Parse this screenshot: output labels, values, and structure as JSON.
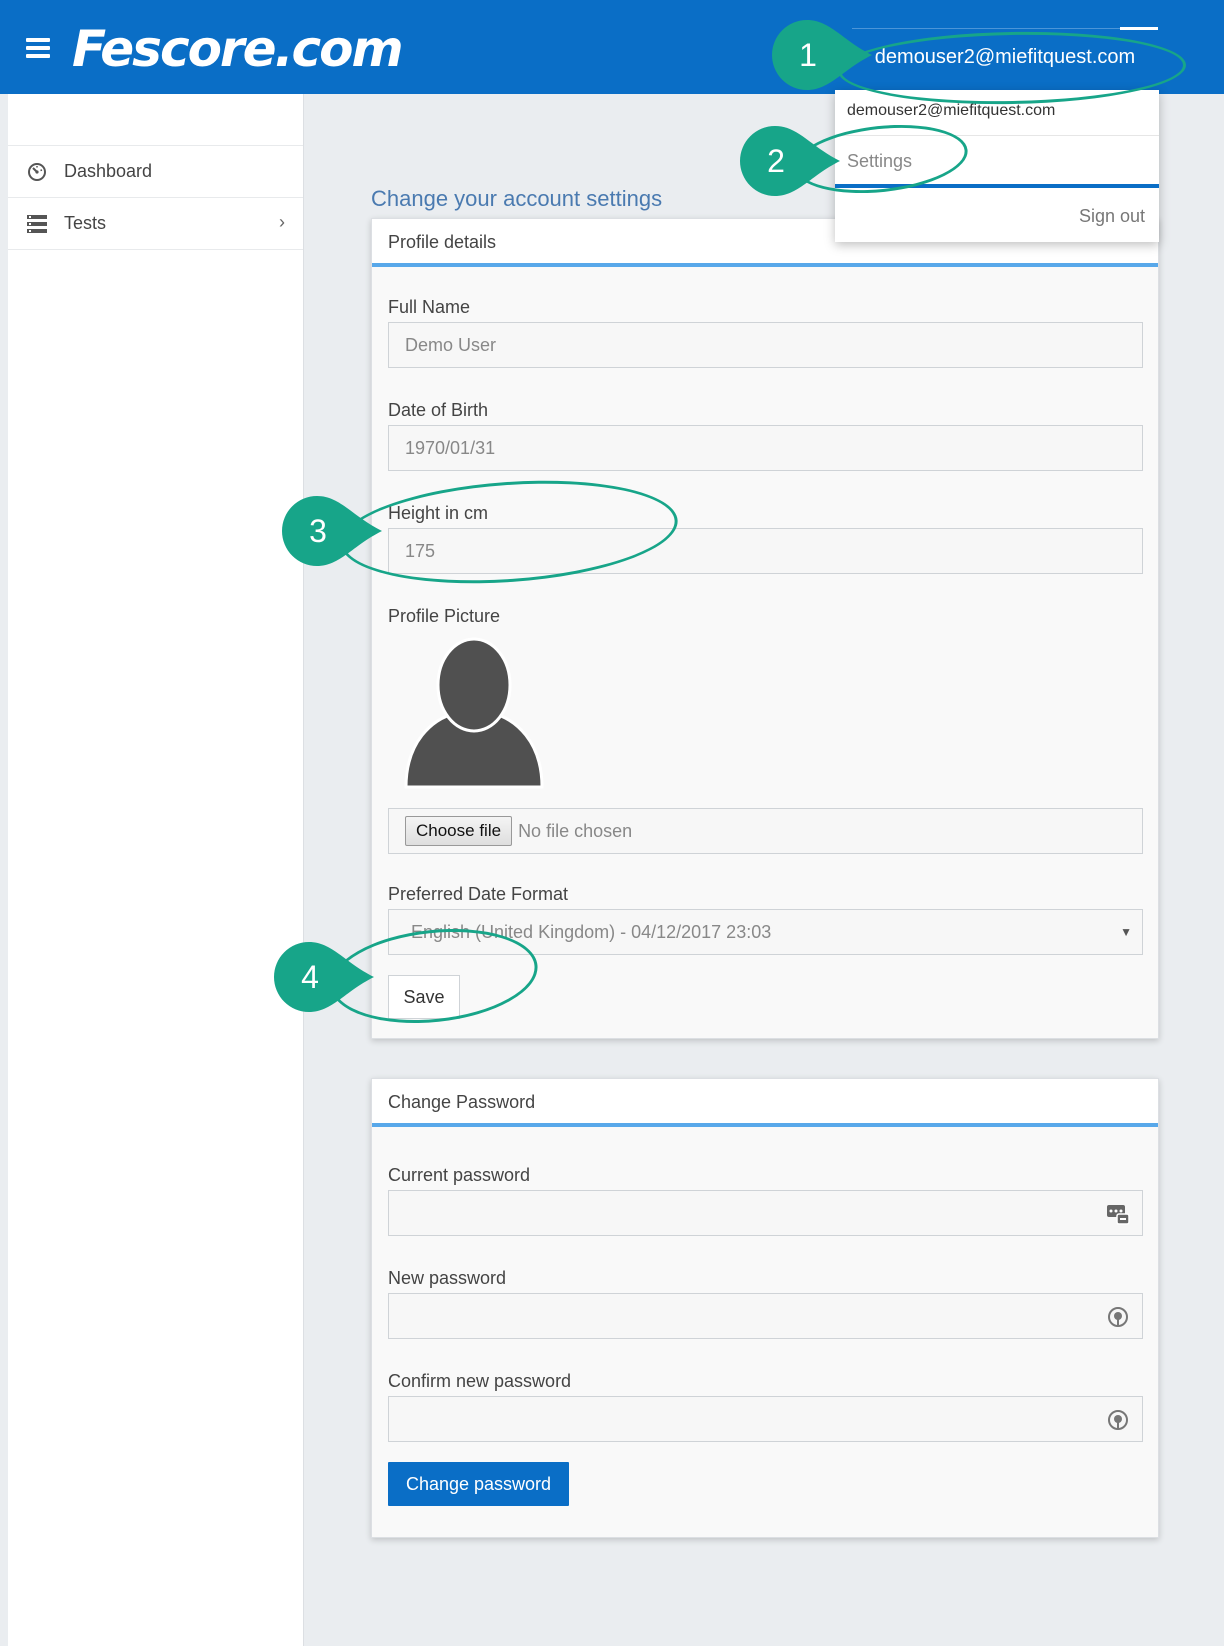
{
  "header": {
    "brand": "Fescore.com",
    "user_email": "demouser2@miefitquest.com"
  },
  "sidebar": {
    "items": [
      {
        "label": "Dashboard",
        "icon": "dashboard-gauge-icon"
      },
      {
        "label": "Tests",
        "icon": "tests-list-icon",
        "chevron": "chevron-right-icon"
      }
    ]
  },
  "page": {
    "title": "Change your account settings"
  },
  "profile": {
    "heading": "Profile details",
    "full_name_label": "Full Name",
    "full_name_value": "Demo User",
    "dob_label": "Date of Birth",
    "dob_value": "1970/01/31",
    "height_label": "Height in cm",
    "height_value": "175",
    "picture_label": "Profile Picture",
    "choose_file_label": "Choose file",
    "no_file_text": "No file chosen",
    "date_format_label": "Preferred Date Format",
    "date_format_value": "English (United Kingdom) - 04/12/2017 23:03",
    "save_label": "Save"
  },
  "password": {
    "heading": "Change Password",
    "current_label": "Current password",
    "new_label": "New password",
    "confirm_label": "Confirm new password",
    "submit_label": "Change password"
  },
  "user_menu": {
    "email": "demouser2@miefitquest.com",
    "settings": "Settings",
    "sign_out": "Sign out"
  },
  "annotations": {
    "one": "1",
    "two": "2",
    "three": "3",
    "four": "4",
    "color": "#17a589"
  }
}
